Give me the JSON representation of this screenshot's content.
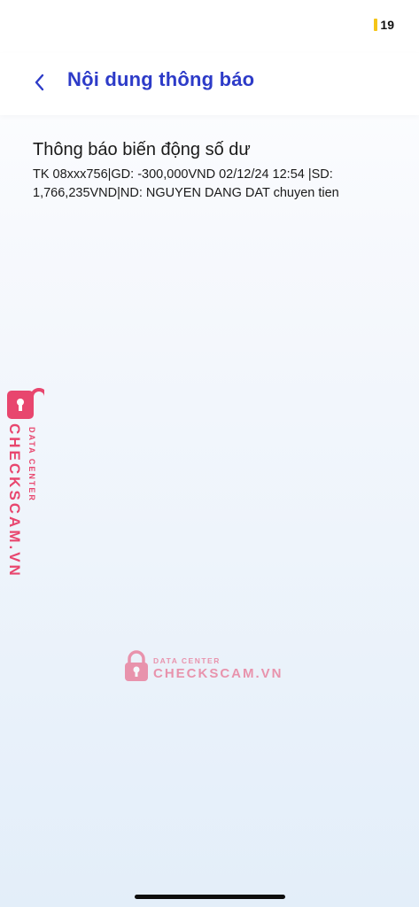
{
  "status_bar": {
    "battery_level": "19",
    "battery_color": "#f5c518"
  },
  "header": {
    "title": "Nội dung thông báo",
    "back_icon": "chevron-left-icon",
    "accent_color": "#2d3bc8"
  },
  "notification": {
    "title": "Thông báo biến động số dư",
    "body": "TK 08xxx756|GD: -300,000VND 02/12/24 12:54 |SD: 1,766,235VND|ND: NGUYEN DANG DAT chuyen tien"
  },
  "watermark": {
    "brand": "CHECKSCAM.VN",
    "subtitle": "DATA CENTER",
    "color": "#e8466e"
  }
}
